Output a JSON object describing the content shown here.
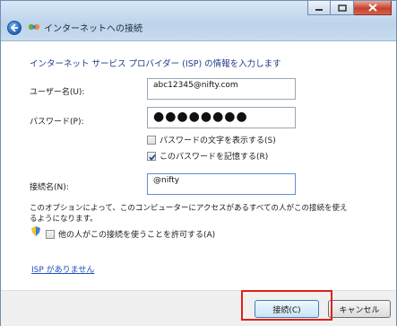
{
  "window": {
    "title": "インターネットへの接続",
    "controls": [
      "minimize",
      "maximize",
      "close"
    ]
  },
  "form": {
    "heading": "インターネット サービス プロバイダー (ISP) の情報を入力します",
    "username": {
      "label": "ユーザー名(U):",
      "value": "abc12345@nifty.com"
    },
    "password": {
      "label": "パスワード(P):",
      "value": "●●●●●●●●"
    },
    "show_password": {
      "label": "パスワードの文字を表示する(S)",
      "checked": false
    },
    "remember_password": {
      "label": "このパスワードを記憶する(R)",
      "checked": true
    },
    "connection_name": {
      "label": "接続名(N):",
      "value": "@nifty"
    },
    "note": "このオプションによって、このコンピューターにアクセスがあるすべての人がこの接続を使えるようになります。",
    "allow_others": {
      "label": "他の人がこの接続を使うことを許可する(A)",
      "checked": false
    },
    "no_isp_link": "ISP がありません"
  },
  "buttons": {
    "connect": "接続(C)",
    "cancel": "キャンセル"
  },
  "colors": {
    "heading": "#1f3a8a",
    "link": "#1f4fbe",
    "highlight": "#e0201a"
  }
}
